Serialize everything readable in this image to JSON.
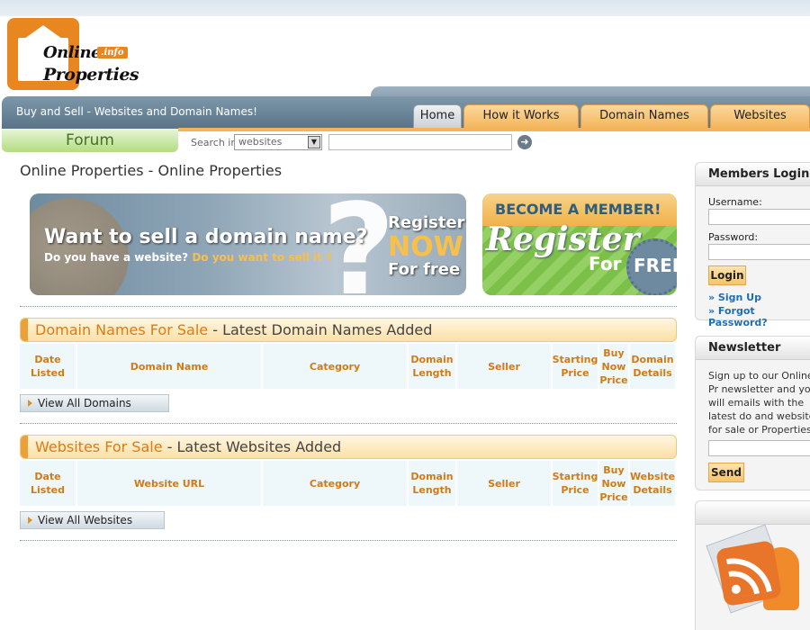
{
  "logo": {
    "line1": "Online",
    "line2": "Properties",
    "badge": ".info"
  },
  "header": {
    "tagline": "Buy and Sell - Websites and Domain Names!"
  },
  "nav": {
    "tabs": [
      {
        "label": "Home"
      },
      {
        "label": "How it Works"
      },
      {
        "label": "Domain Names"
      },
      {
        "label": "Websites"
      }
    ]
  },
  "forum": {
    "label": "Forum"
  },
  "search": {
    "label": "Search in",
    "selected": "websites",
    "value": "",
    "go_icon": "arrow-right-circle-icon"
  },
  "page": {
    "title": "Online Properties - Online Properties"
  },
  "banner1": {
    "line1": "Want to sell a domain name?",
    "line2a": "Do you have a website?",
    "line2b": "Do you want to sell it ?",
    "register": "Register",
    "now": "NOW",
    "forfree": "For free"
  },
  "banner2": {
    "become": "BECOME A MEMBER!",
    "register": "Register",
    "for": "For",
    "free": "FREE"
  },
  "domains": {
    "title_accent": "Domain Names For Sale",
    "title_rest": " - Latest Domain Names Added",
    "columns": [
      "Date Listed",
      "Domain Name",
      "Category",
      "Domain Length",
      "Seller",
      "Starting Price",
      "Buy Now Price",
      "Domain Details"
    ],
    "view_all": "View All Domains"
  },
  "websites": {
    "title_accent": "Websites For Sale",
    "title_rest": " - Latest Websites Added",
    "columns": [
      "Date Listed",
      "Website URL",
      "Category",
      "Domain Length",
      "Seller",
      "Starting Price",
      "Buy Now Price",
      "Website Details"
    ],
    "view_all": "View All Websites"
  },
  "login": {
    "title": "Members Login",
    "username_label": "Username:",
    "password_label": "Password:",
    "button": "Login",
    "signup": "» Sign Up",
    "forgot": "» Forgot Password?"
  },
  "newsletter": {
    "title": "Newsletter",
    "text": "Sign up to our Online Pr newsletter and you will emails with the latest do and websites for sale or Properties:",
    "button": "Send"
  },
  "colors": {
    "orange": "#f3b45a",
    "blue": "#5a7386",
    "green": "#b3dc82",
    "header_orange_text": "#e07a12"
  }
}
